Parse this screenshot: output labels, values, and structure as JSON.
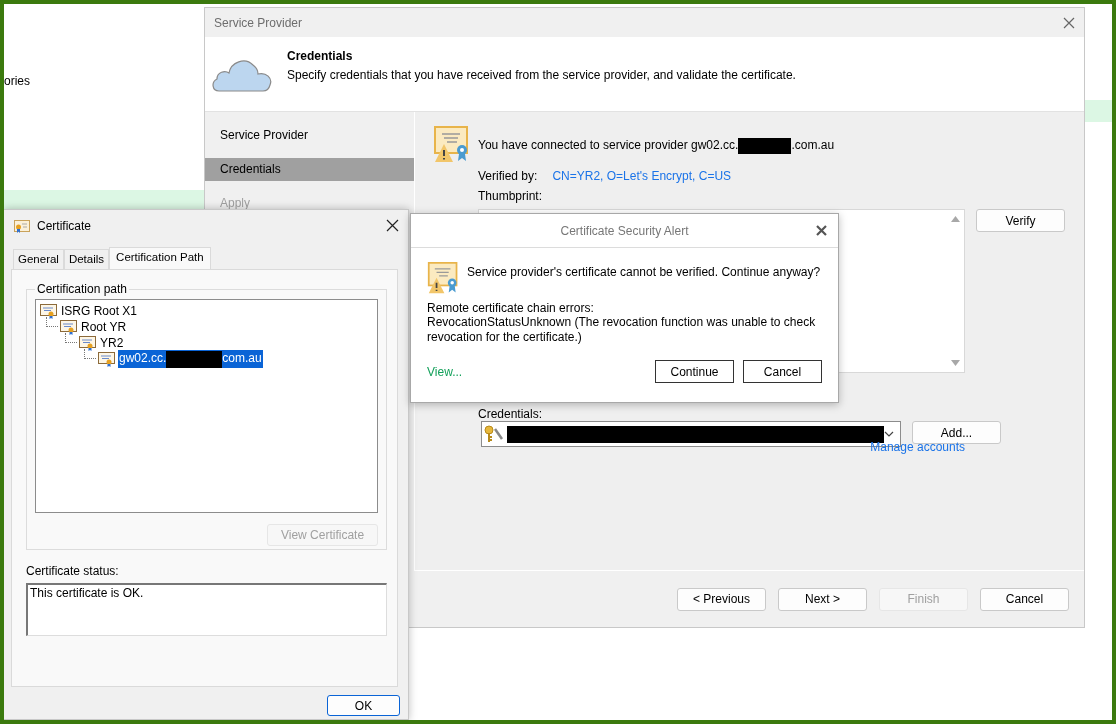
{
  "background": {
    "partial_text": "ories"
  },
  "service_provider_window": {
    "title": "Service Provider",
    "header": {
      "title": "Credentials",
      "subtitle": "Specify credentials that you have received from the service provider, and validate the certificate."
    },
    "steps": [
      {
        "label": "Service Provider",
        "selected": false,
        "disabled": false
      },
      {
        "label": "Credentials",
        "selected": true,
        "disabled": false
      },
      {
        "label": "Apply",
        "selected": false,
        "disabled": true
      }
    ],
    "connection": {
      "text_start": "You have connected to service provider gw02.cc.",
      "redacted": true,
      "text_end": ".com.au"
    },
    "verified_by": {
      "label": "Verified by:",
      "value": "CN=YR2, O=Let's Encrypt, C=US"
    },
    "thumbprint": {
      "label": "Thumbprint:"
    },
    "verify_button": "Verify",
    "credentials": {
      "label": "Credentials:",
      "redacted": true
    },
    "add_button": "Add...",
    "manage_link": "Manage accounts",
    "buttons": [
      {
        "label": "< Previous",
        "disabled": false
      },
      {
        "label": "Next >",
        "disabled": false
      },
      {
        "label": "Finish",
        "disabled": true
      },
      {
        "label": "Cancel",
        "disabled": false
      }
    ]
  },
  "certificate_window": {
    "title": "Certificate",
    "tabs": [
      {
        "label": "General",
        "selected": false
      },
      {
        "label": "Details",
        "selected": false
      },
      {
        "label": "Certification Path",
        "selected": true
      }
    ],
    "group_label": "Certification path",
    "tree": [
      {
        "label": "ISRG Root X1",
        "selected": false,
        "children": [
          {
            "label": "Root YR",
            "selected": false,
            "children": [
              {
                "label": "YR2",
                "selected": false,
                "children": [
                  {
                    "label": "gw02.cc.",
                    "label_end": "com.au",
                    "redacted": true,
                    "selected": true
                  }
                ]
              }
            ]
          }
        ]
      }
    ],
    "view_button": {
      "label": "View Certificate",
      "disabled": true
    },
    "status_label": "Certificate status:",
    "status_text": "This certificate is OK.",
    "ok_button": "OK"
  },
  "alert": {
    "title": "Certificate Security Alert",
    "message": "Service provider's certificate cannot be verified. Continue anyway?",
    "errors_heading": "Remote certificate chain errors:",
    "error_detail": "RevocationStatusUnknown (The revocation function was unable to check revocation for the certificate.)",
    "view_link": "View...",
    "buttons": [
      {
        "label": "Continue"
      },
      {
        "label": "Cancel"
      }
    ]
  }
}
